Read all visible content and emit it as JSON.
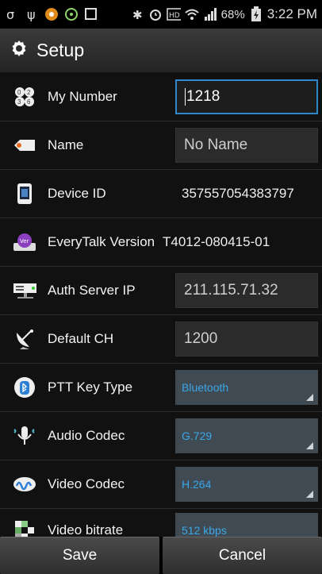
{
  "status_bar": {
    "battery": "68%",
    "time": "3:22 PM"
  },
  "action_bar": {
    "title": "Setup",
    "icon": "gear-icon"
  },
  "rows": [
    {
      "label": "My Number",
      "value": "1218",
      "icon": "number-grid-icon"
    },
    {
      "label": "Name",
      "value": "No Name",
      "icon": "tag-icon"
    },
    {
      "label": "Device ID",
      "value": "357557054383797",
      "icon": "phone-device-icon"
    },
    {
      "label": "EveryTalk Version",
      "value": "T4012-080415-01",
      "icon": "version-icon"
    },
    {
      "label": "Auth Server IP",
      "value": "211.115.71.32",
      "icon": "server-icon"
    },
    {
      "label": "Default CH",
      "value": "1200",
      "icon": "satellite-dish-icon"
    },
    {
      "label": "PTT Key Type",
      "value": "Bluetooth",
      "icon": "bluetooth-icon"
    },
    {
      "label": "Audio Codec",
      "value": "G.729",
      "icon": "microphone-icon"
    },
    {
      "label": "Video Codec",
      "value": "H.264",
      "icon": "video-codec-icon"
    },
    {
      "label": "Video bitrate",
      "value": "512 kbps",
      "icon": "bitrate-icon"
    }
  ],
  "buttons": {
    "save": "Save",
    "cancel": "Cancel"
  },
  "colors": {
    "accent": "#2f86c8",
    "spinner_text": "#3ba7e8",
    "background": "#111111"
  }
}
